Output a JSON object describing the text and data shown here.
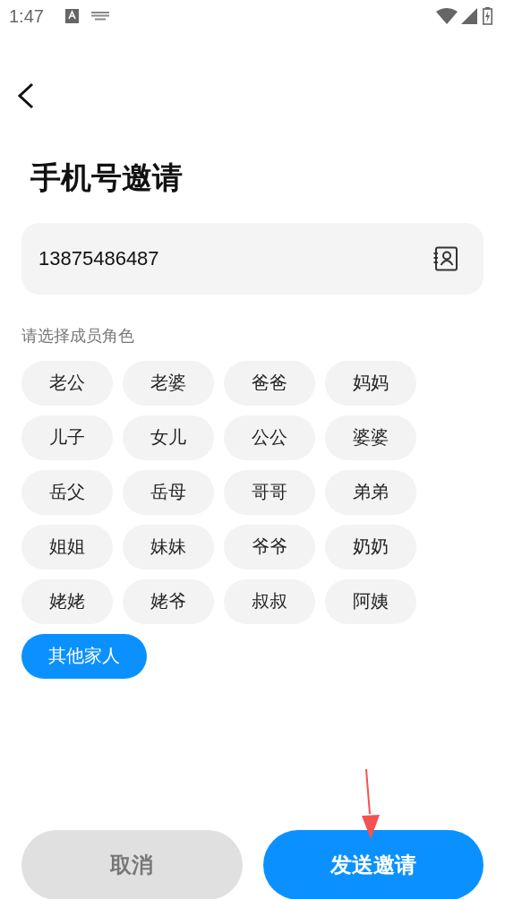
{
  "status_bar": {
    "time": "1:47"
  },
  "title": "手机号邀请",
  "phone_field": {
    "value": "13875486487"
  },
  "roles_label": "请选择成员角色",
  "roles": [
    {
      "label": "老公",
      "selected": false
    },
    {
      "label": "老婆",
      "selected": false
    },
    {
      "label": "爸爸",
      "selected": false
    },
    {
      "label": "妈妈",
      "selected": false
    },
    {
      "label": "儿子",
      "selected": false
    },
    {
      "label": "女儿",
      "selected": false
    },
    {
      "label": "公公",
      "selected": false
    },
    {
      "label": "婆婆",
      "selected": false
    },
    {
      "label": "岳父",
      "selected": false
    },
    {
      "label": "岳母",
      "selected": false
    },
    {
      "label": "哥哥",
      "selected": false
    },
    {
      "label": "弟弟",
      "selected": false
    },
    {
      "label": "姐姐",
      "selected": false
    },
    {
      "label": "妹妹",
      "selected": false
    },
    {
      "label": "爷爷",
      "selected": false
    },
    {
      "label": "奶奶",
      "selected": false
    },
    {
      "label": "姥姥",
      "selected": false
    },
    {
      "label": "姥爷",
      "selected": false
    },
    {
      "label": "叔叔",
      "selected": false
    },
    {
      "label": "阿姨",
      "selected": false
    },
    {
      "label": "其他家人",
      "selected": true
    }
  ],
  "buttons": [
    {
      "kind": "cancel",
      "label": "取消"
    },
    {
      "kind": "primary",
      "label": "发送邀请"
    }
  ],
  "annotations": [
    {
      "kind": "arrow",
      "color": "#f45252"
    }
  ]
}
